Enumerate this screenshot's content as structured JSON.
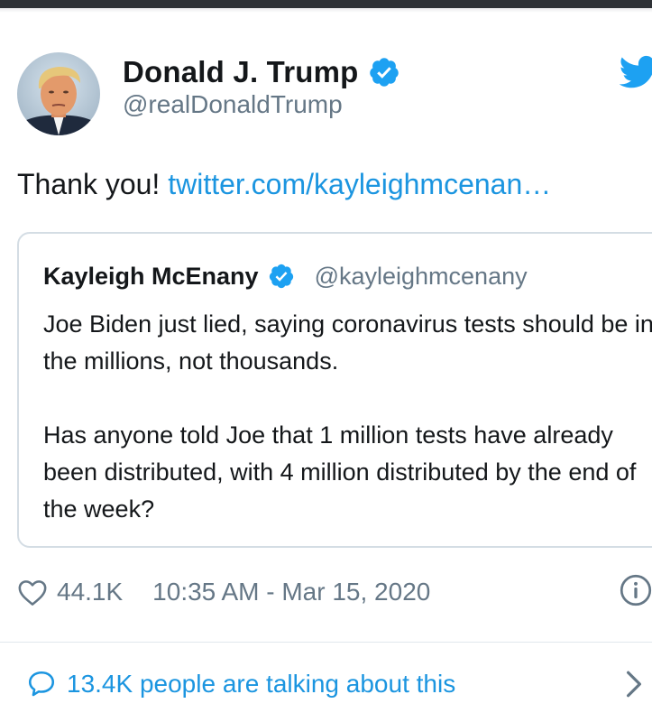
{
  "author": {
    "display_name": "Donald J. Trump",
    "handle": "@realDonaldTrump",
    "verified": true
  },
  "tweet": {
    "text": "Thank you!",
    "link": "twitter.com/kayleighmcenan…"
  },
  "quoted_tweet": {
    "display_name": "Kayleigh McEnany",
    "handle": "@kayleighmcenany",
    "verified": true,
    "paragraph_1": "Joe Biden just lied, saying coronavirus tests should be in the millions, not thousands.",
    "paragraph_2": "Has anyone told Joe that 1 million tests have already been distributed, with 4 million distributed by the end of the week?"
  },
  "stats": {
    "likes": "44.1K",
    "timestamp": "10:35 AM - Mar 15, 2020"
  },
  "conversation": {
    "label": "13.4K people are talking about this"
  },
  "icons": {
    "brand": "twitter-bird-icon",
    "verified": "verified-badge-icon",
    "like": "heart-icon",
    "info": "info-icon",
    "reply": "speech-bubble-icon",
    "more": "chevron-right-icon"
  },
  "colors": {
    "link": "#1b95e0",
    "verified": "#1da1f2",
    "secondary_text": "#657786",
    "border": "#d4dde4"
  }
}
